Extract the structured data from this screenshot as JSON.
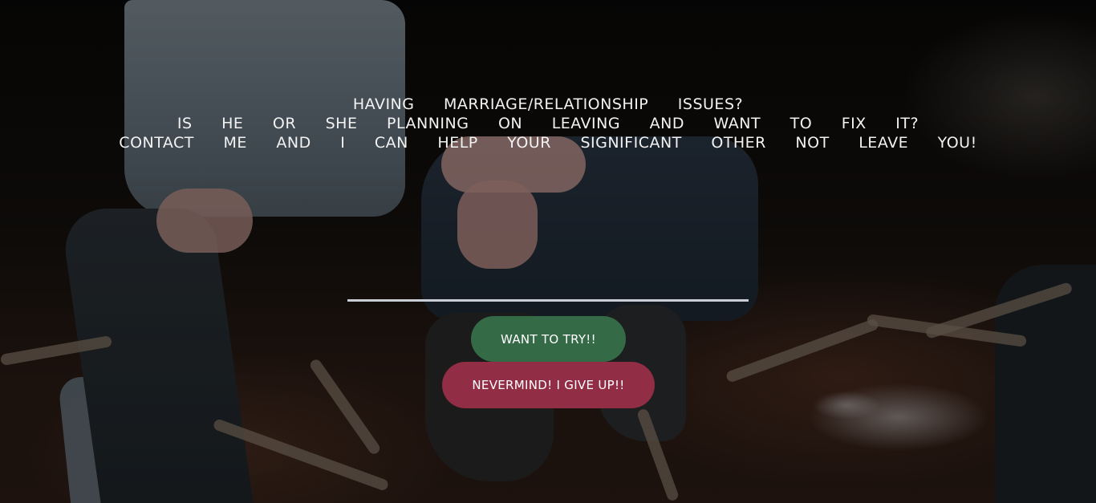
{
  "headline": {
    "line1": "HAVING MARRIAGE/RELATIONSHIP ISSUES?",
    "line2": "IS HE OR SHE PLANNING ON LEAVING AND WANT TO FIX IT?",
    "line3": "CONTACT ME AND I CAN HELP YOUR SIGNIFICANT OTHER NOT LEAVE YOU!"
  },
  "buttons": {
    "try_label": "WANT TO TRY!!",
    "giveup_label": "NEVERMIND! I GIVE UP!!"
  },
  "colors": {
    "try_button": "#346a46",
    "giveup_button": "#912d44",
    "divider": "#c9ced6",
    "text": "#f2f2f2"
  }
}
